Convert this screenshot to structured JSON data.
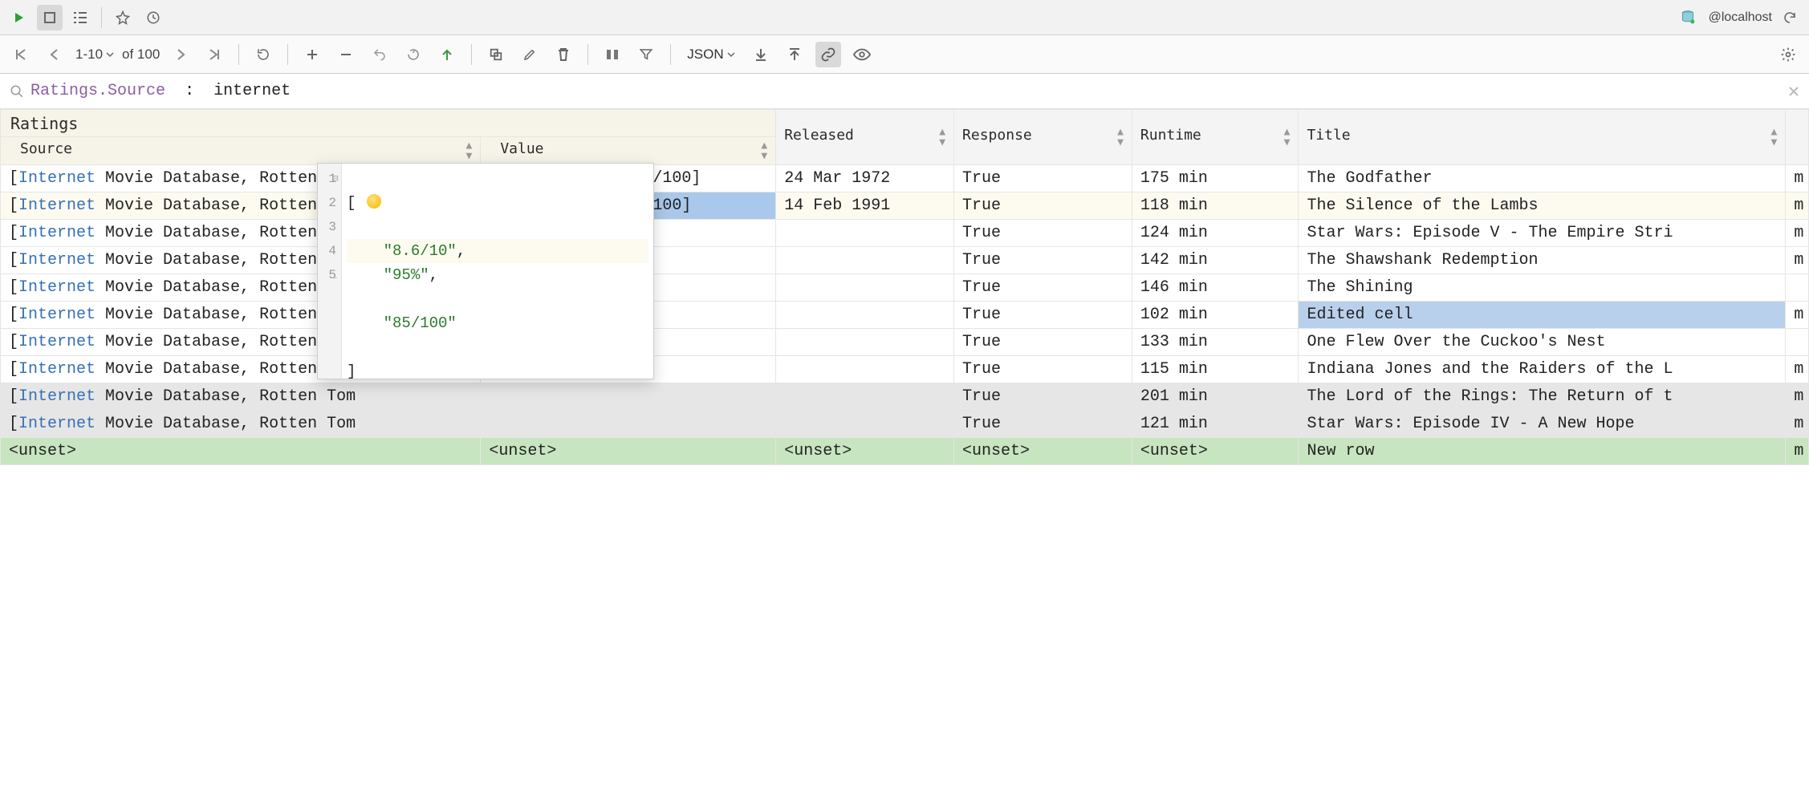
{
  "top_toolbar": {
    "connection_label": "@localhost"
  },
  "nav": {
    "range_label": "1-10",
    "total_label": "of 100",
    "view_dropdown": "JSON"
  },
  "filter": {
    "field": "Ratings.Source",
    "op": ":",
    "value": "internet"
  },
  "columns": {
    "group_ratings": "Ratings",
    "source": "Source",
    "value": "Value",
    "released": "Released",
    "response": "Response",
    "runtime": "Runtime",
    "title": "Title"
  },
  "rows": [
    {
      "source_prefix": "Internet",
      "source_rest": " Movie Database, Rotten Tomat",
      "value": "[9.2/10, 97%, 100/100]",
      "released": "24 Mar 1972",
      "response": "True",
      "runtime": "175 min",
      "title": "The Godfather",
      "m": "m"
    },
    {
      "source_prefix": "Internet",
      "source_rest": " Movie Database, Rotten Tomat",
      "value": "[8.6/10, 95%, 85/100]",
      "released": "14 Feb 1991",
      "response": "True",
      "runtime": "118 min",
      "title": "The Silence of the Lambs",
      "m": "m"
    },
    {
      "source_prefix": "Internet",
      "source_rest": " Movie Database, Rotten Tom",
      "value": "",
      "released": "",
      "response": "True",
      "runtime": "124 min",
      "title": "Star Wars: Episode V - The Empire Stri",
      "m": "m"
    },
    {
      "source_prefix": "Internet",
      "source_rest": " Movie Database, Rotten Tom",
      "value": "",
      "released": "",
      "response": "True",
      "runtime": "142 min",
      "title": "The Shawshank Redemption",
      "m": "m"
    },
    {
      "source_prefix": "Internet",
      "source_rest": " Movie Database, Rotten Tom",
      "value": "",
      "released": "",
      "response": "True",
      "runtime": "146 min",
      "title": "The Shining",
      "m": ""
    },
    {
      "source_prefix": "Internet",
      "source_rest": " Movie Database, Rotten Tom",
      "value": "",
      "released": "",
      "response": "True",
      "runtime": "102 min",
      "title": "Edited cell",
      "m": "m"
    },
    {
      "source_prefix": "Internet",
      "source_rest": " Movie Database, Rotten Tom",
      "value": "",
      "released": "",
      "response": "True",
      "runtime": "133 min",
      "title": "One Flew Over the Cuckoo's Nest",
      "m": ""
    },
    {
      "source_prefix": "Internet",
      "source_rest": " Movie Database, Rotten Tom",
      "value": "",
      "released": "",
      "response": "True",
      "runtime": "115 min",
      "title": "Indiana Jones and the Raiders of the L",
      "m": "m"
    },
    {
      "source_prefix": "Internet",
      "source_rest": " Movie Database, Rotten Tom",
      "value": "",
      "released": "",
      "response": "True",
      "runtime": "201 min",
      "title": "The Lord of the Rings: The Return of t",
      "m": "m"
    },
    {
      "source_prefix": "Internet",
      "source_rest": " Movie Database, Rotten Tom",
      "value": "",
      "released": "",
      "response": "True",
      "runtime": "121 min",
      "title": "Star Wars: Episode IV - A New Hope",
      "m": "m"
    }
  ],
  "new_row": {
    "source": "<unset>",
    "value": "<unset>",
    "released": "<unset>",
    "response": "<unset>",
    "runtime": "<unset>",
    "title": "New row",
    "m": "m"
  },
  "popup": {
    "line1": "[",
    "line2": "    \"8.6/10\",",
    "line3": "    \"95%\",",
    "line4": "    \"85/100\"",
    "line5": "]",
    "gutter": [
      "1",
      "2",
      "3",
      "4",
      "5"
    ]
  }
}
